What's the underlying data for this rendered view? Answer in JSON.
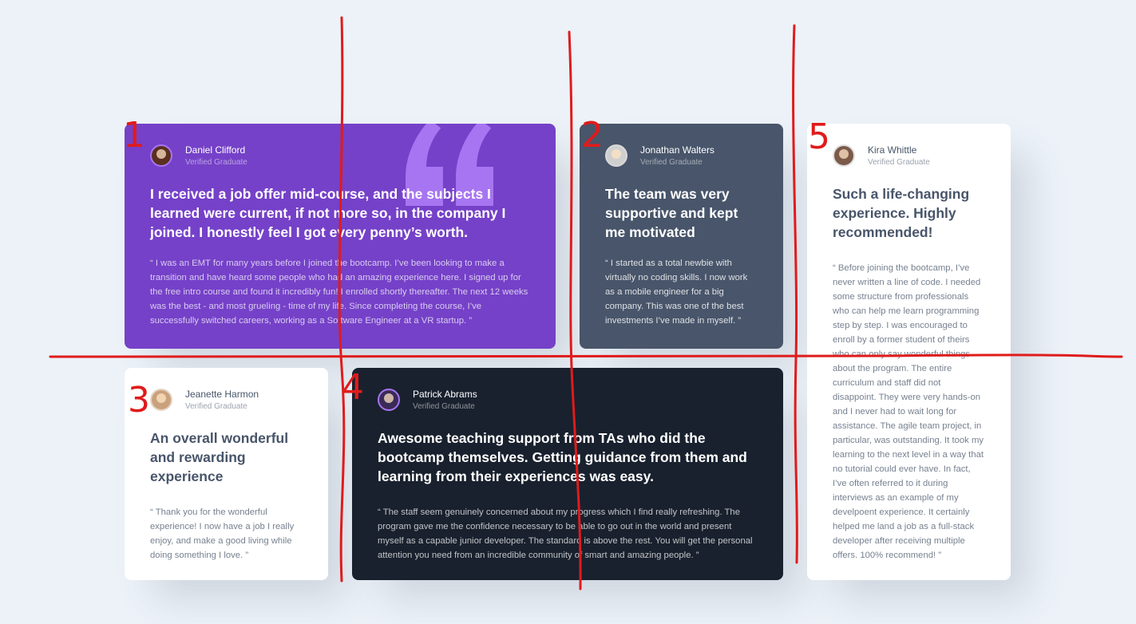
{
  "colors": {
    "background": "#ecf2f8",
    "purple": "#7541c8",
    "grayish_blue": "#48556a",
    "very_dark_blue": "#19212e",
    "white": "#ffffff",
    "annotation_red": "#e01b1b",
    "quote_mark": "#a775f1"
  },
  "annotations": [
    "1",
    "2",
    "3",
    "4",
    "5"
  ],
  "testimonials": [
    {
      "name": "Daniel Clifford",
      "role": "Verified Graduate",
      "headline": "I received a job offer mid-course, and the subjects I learned were current, if not more so, in the company I joined. I honestly feel I got every penny’s worth.",
      "quote": "“ I was an EMT for many years before I joined the bootcamp. I’ve been looking to make a transition and have heard some people who had an amazing experience here. I signed up for the free intro course and found it incredibly fun! I enrolled shortly thereafter. The next 12 weeks was the  best - and most grueling - time of my life. Since completing the course, I’ve successfully switched careers, working as a Software Engineer at a VR startup. ”"
    },
    {
      "name": "Jonathan Walters",
      "role": "Verified Graduate",
      "headline": "The team was very supportive and kept me motivated",
      "quote": "“ I started as a total newbie with virtually no coding skills. I now work as a mobile engineer for a big company. This was one of the best investments I’ve made in myself. ”"
    },
    {
      "name": "Jeanette Harmon",
      "role": "Verified Graduate",
      "headline": "An overall wonderful and rewarding experience",
      "quote": "“ Thank you for the wonderful experience! I now have a job I really enjoy, and make a good living while doing something I love. ”"
    },
    {
      "name": "Patrick Abrams",
      "role": "Verified Graduate",
      "headline": "Awesome teaching support from TAs who did the bootcamp themselves. Getting guidance from them and learning from their experiences was easy.",
      "quote": "“ The staff seem genuinely concerned about my progress which I find really refreshing. The program gave me the confidence necessary to be able to go out in the world and present myself as a capable junior developer. The standard is above the rest. You will get the personal attention you need from an incredible community of smart and amazing people.  ”"
    },
    {
      "name": "Kira Whittle",
      "role": "Verified Graduate",
      "headline": "Such a life-changing experience. Highly recommended!",
      "quote": "“ Before joining the bootcamp, I’ve never written a line of code. I needed some structure from professionals who can help me learn programming step by step. I was encouraged to enroll by a former student of theirs who can only say wonderful things about the program. The entire curriculum and staff did not disappoint. They were very hands-on and I never had to wait long for assistance. The agile team project, in particular, was outstanding. It took my learning to the next level in a way that no tutorial could ever have. In fact, I’ve often referred to it during interviews as an example of my develpoent experience. It certainly helped me land a job as a full-stack developer after receiving multiple offers. 100% recommend!  ”"
    }
  ]
}
